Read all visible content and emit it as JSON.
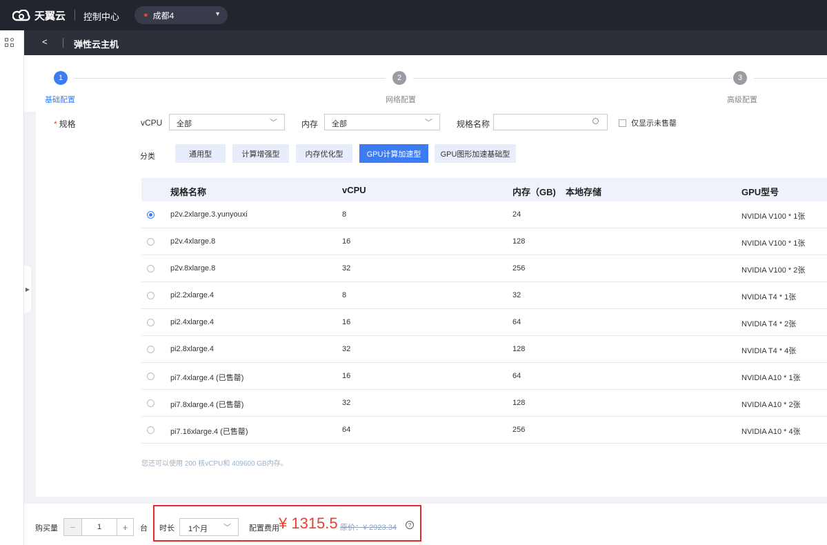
{
  "topbar": {
    "brand": "天翼云",
    "console": "控制中心",
    "region": "成都4"
  },
  "subheader": {
    "back_icon": "chevron-left-icon",
    "title": "弹性云主机"
  },
  "steps": [
    {
      "num": "1",
      "label": "基础配置",
      "active": true
    },
    {
      "num": "2",
      "label": "网络配置",
      "active": false
    },
    {
      "num": "3",
      "label": "高级配置",
      "active": false
    }
  ],
  "filters": {
    "spec_label": "规格",
    "vcpu_label": "vCPU",
    "vcpu_value": "全部",
    "mem_label": "内存",
    "mem_value": "全部",
    "name_label": "规格名称",
    "name_placeholder": "",
    "only_unsold": "仅显示未售罄"
  },
  "categories": {
    "label": "分类",
    "items": [
      "通用型",
      "计算增强型",
      "内存优化型",
      "GPU计算加速型",
      "GPU图形加速基础型"
    ],
    "active_index": 3
  },
  "table": {
    "headers": [
      "规格名称",
      "vCPU",
      "内存（GB)",
      "本地存储",
      "GPU型号"
    ],
    "rows": [
      {
        "name": "p2v.2xlarge.3.yunyouxi",
        "vcpu": "8",
        "mem": "24",
        "storage": "",
        "gpu": "NVIDIA V100 * 1张",
        "selected": true
      },
      {
        "name": "p2v.4xlarge.8",
        "vcpu": "16",
        "mem": "128",
        "storage": "",
        "gpu": "NVIDIA V100 * 1张",
        "selected": false
      },
      {
        "name": "p2v.8xlarge.8",
        "vcpu": "32",
        "mem": "256",
        "storage": "",
        "gpu": "NVIDIA V100 * 2张",
        "selected": false
      },
      {
        "name": "pi2.2xlarge.4",
        "vcpu": "8",
        "mem": "32",
        "storage": "",
        "gpu": "NVIDIA T4 * 1张",
        "selected": false
      },
      {
        "name": "pi2.4xlarge.4",
        "vcpu": "16",
        "mem": "64",
        "storage": "",
        "gpu": "NVIDIA T4 * 2张",
        "selected": false
      },
      {
        "name": "pi2.8xlarge.4",
        "vcpu": "32",
        "mem": "128",
        "storage": "",
        "gpu": "NVIDIA T4 * 4张",
        "selected": false
      },
      {
        "name": "pi7.4xlarge.4 (已售罄)",
        "vcpu": "16",
        "mem": "64",
        "storage": "",
        "gpu": "NVIDIA A10 * 1张",
        "selected": false
      },
      {
        "name": "pi7.8xlarge.4 (已售罄)",
        "vcpu": "32",
        "mem": "128",
        "storage": "",
        "gpu": "NVIDIA A10 * 2张",
        "selected": false
      },
      {
        "name": "pi7.16xlarge.4 (已售罄)",
        "vcpu": "64",
        "mem": "256",
        "storage": "",
        "gpu": "NVIDIA A10 * 4张",
        "selected": false
      }
    ],
    "quota_note": "您还可以使用 200 核vCPU和 409600 GB内存。"
  },
  "bottom": {
    "qty_label": "购买量",
    "qty_value": "1",
    "unit": "台",
    "duration_label": "时长",
    "duration_value": "1个月",
    "fee_label": "配置费用",
    "price": "¥ 1315.5",
    "original_price": "原价：¥ 2923.34",
    "help_icon": "question-circle-icon"
  },
  "colors": {
    "accent": "#3b7cf2",
    "price": "#e8412c",
    "topbar": "#23252e",
    "highlight_box": "#e12a2a"
  }
}
